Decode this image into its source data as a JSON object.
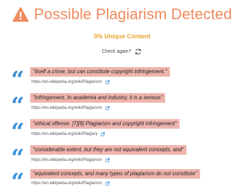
{
  "header": {
    "title": "Possible Plagiarism Detected",
    "warning_color": "#f08a5d"
  },
  "summary": {
    "unique_content": "0% Unique Content"
  },
  "check_again": {
    "label": "Check again?",
    "icon": "refresh-icon"
  },
  "accent": {
    "quote_color": "#3d8fd6",
    "highlight_color": "#efb4ae",
    "unique_color": "#e9a42c"
  },
  "results": [
    {
      "snippet": "\"itself a crime, but can constitute copyright infringement.\"",
      "source": "https://en.wikipedia.org/wiki/Plagiarism"
    },
    {
      "snippet": "\"infringement. In academia and industry, it is a serious\"",
      "source": "https://en.wikipedia.org/wiki/Plagiarism"
    },
    {
      "snippet": "\"ethical offense. [7][8] Plagiarism and copyright infringement\"",
      "source": "https://en.wikipedia.org/wiki/Plagiary"
    },
    {
      "snippet": "\"considerable extent, but they are not equivalent concepts, and\"",
      "source": "https://en.wikipedia.org/wiki/Plagiarism"
    },
    {
      "snippet": "\"equivalent concepts, and many types of plagiarism do not constitute\"",
      "source": "https://en.wikipedia.org/wiki/Plagiarism"
    }
  ]
}
